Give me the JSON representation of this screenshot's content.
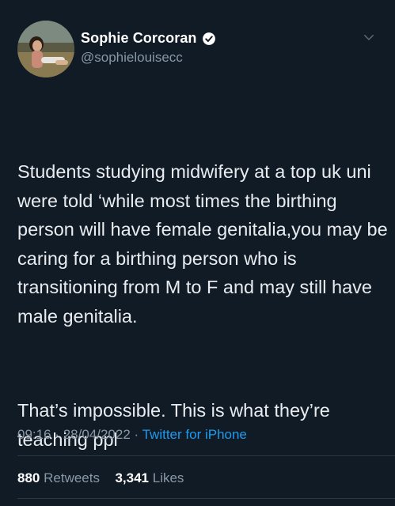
{
  "author": {
    "display_name": "Sophie Corcoran",
    "handle": "@sophielouisecc",
    "avatar_icon": "user-avatar-photo",
    "verified_icon": "verified-badge-icon",
    "verified_color": "#ffffff"
  },
  "tweet": {
    "paragraph_1": "Students studying midwifery at a top uk uni were told ‘while most times the birthing person will have female genitalia,you may be caring for a birthing person who is transitioning from M to F and may still have male genitalia.",
    "paragraph_2": "That’s impossible. This is what they’re teaching ppl"
  },
  "meta": {
    "time": "09:16",
    "separator": "·",
    "date": "28/04/2022",
    "source": "Twitter for iPhone"
  },
  "stats": {
    "retweets_count": "880",
    "retweets_label": "Retweets",
    "likes_count": "3,341",
    "likes_label": "Likes"
  },
  "colors": {
    "background": "#111b26",
    "text": "#e9ecef",
    "muted": "#8899a6",
    "link": "#1d9bf0"
  }
}
